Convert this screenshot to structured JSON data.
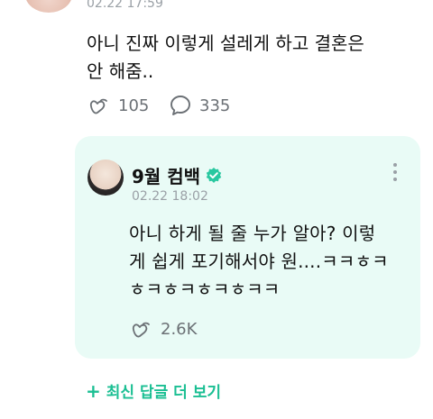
{
  "post": {
    "timestamp": "02.22 17:59",
    "text_line1": "아니 진짜 이렇게 설레게 하고 결혼은",
    "text_line2": "안 해줌..",
    "like_count": "105",
    "comment_count": "335"
  },
  "reply": {
    "author": "9월 컴백",
    "timestamp": "02.22 18:02",
    "text_line1": "아니 하게 될 줄 누가 알아? 이렇",
    "text_line2": "게 쉽게 포기해서야 원....ㅋㅋㅎㅋ",
    "text_line3": "ㅎㅋㅎㅋㅎㅋㅎㅋㅋ",
    "like_count": "2.6K",
    "verified_color": "#29c8a0"
  },
  "more_replies_label": "최신 답글 더 보기",
  "accent_color": "#1bbf93",
  "icons": {
    "like": "heart-hand-icon",
    "comment": "speech-bubble-icon",
    "verified": "verified-badge-icon",
    "more": "more-vertical-icon",
    "plus": "plus-icon"
  }
}
